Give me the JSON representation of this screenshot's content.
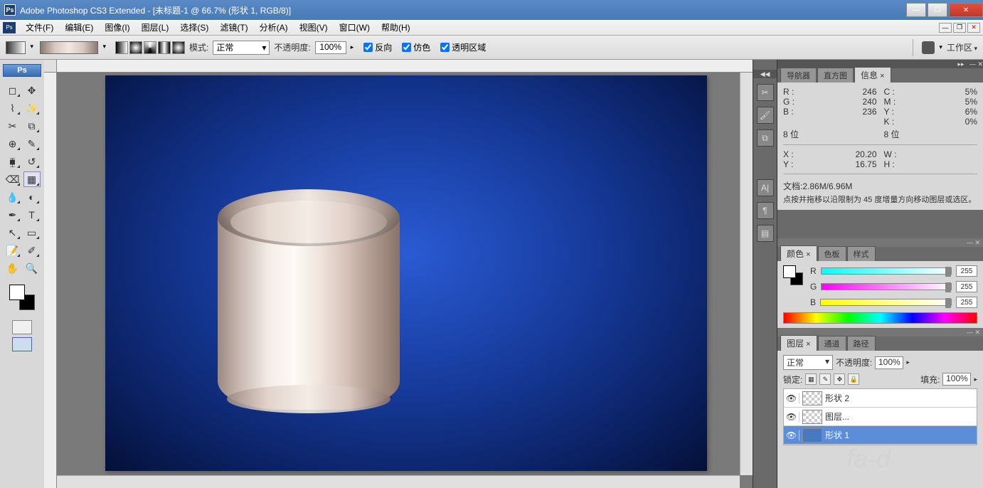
{
  "titlebar": {
    "app": "Adobe Photoshop CS3 Extended",
    "doc": "[未标题-1 @ 66.7% (形状 1, RGB/8)]"
  },
  "menu": {
    "file": "文件(F)",
    "edit": "编辑(E)",
    "image": "图像(I)",
    "layer": "图层(L)",
    "select": "选择(S)",
    "filter": "滤镜(T)",
    "analysis": "分析(A)",
    "view": "视图(V)",
    "window": "窗口(W)",
    "help": "帮助(H)"
  },
  "options": {
    "mode_label": "模式:",
    "mode_value": "正常",
    "opacity_label": "不透明度:",
    "opacity_value": "100%",
    "reverse": "反向",
    "dither": "仿色",
    "transparency": "透明区域",
    "workspace": "工作区"
  },
  "info": {
    "tabs": {
      "navigator": "导航器",
      "histogram": "直方图",
      "info": "信息"
    },
    "rgb": {
      "r_label": "R :",
      "r": "246",
      "g_label": "G :",
      "g": "240",
      "b_label": "B :",
      "b": "236"
    },
    "cmyk": {
      "c_label": "C :",
      "c": "5%",
      "m_label": "M :",
      "m": "5%",
      "y_label": "Y :",
      "y": "6%",
      "k_label": "K :",
      "k": "0%"
    },
    "bits_l": "8 位",
    "bits_r": "8 位",
    "xy": {
      "x_label": "X :",
      "x": "20.20",
      "y_label": "Y :",
      "y": "16.75"
    },
    "wh": {
      "w_label": "W :",
      "h_label": "H :"
    },
    "docinfo": "文档:2.86M/6.96M",
    "hint": "点按并拖移以沿限制为 45 度增量方向移动图层或选区。"
  },
  "color": {
    "tabs": {
      "color": "颜色",
      "swatches": "色板",
      "styles": "样式"
    },
    "r_label": "R",
    "g_label": "G",
    "b_label": "B",
    "r": "255",
    "g": "255",
    "b": "255"
  },
  "layers": {
    "tabs": {
      "layers": "图层",
      "channels": "通道",
      "paths": "路径"
    },
    "blend": "正常",
    "opacity_label": "不透明度:",
    "opacity": "100%",
    "lock_label": "锁定:",
    "fill_label": "填充:",
    "fill": "100%",
    "items": [
      {
        "name": "形状 2"
      },
      {
        "name": "图层..."
      },
      {
        "name": "形状 1"
      }
    ]
  }
}
